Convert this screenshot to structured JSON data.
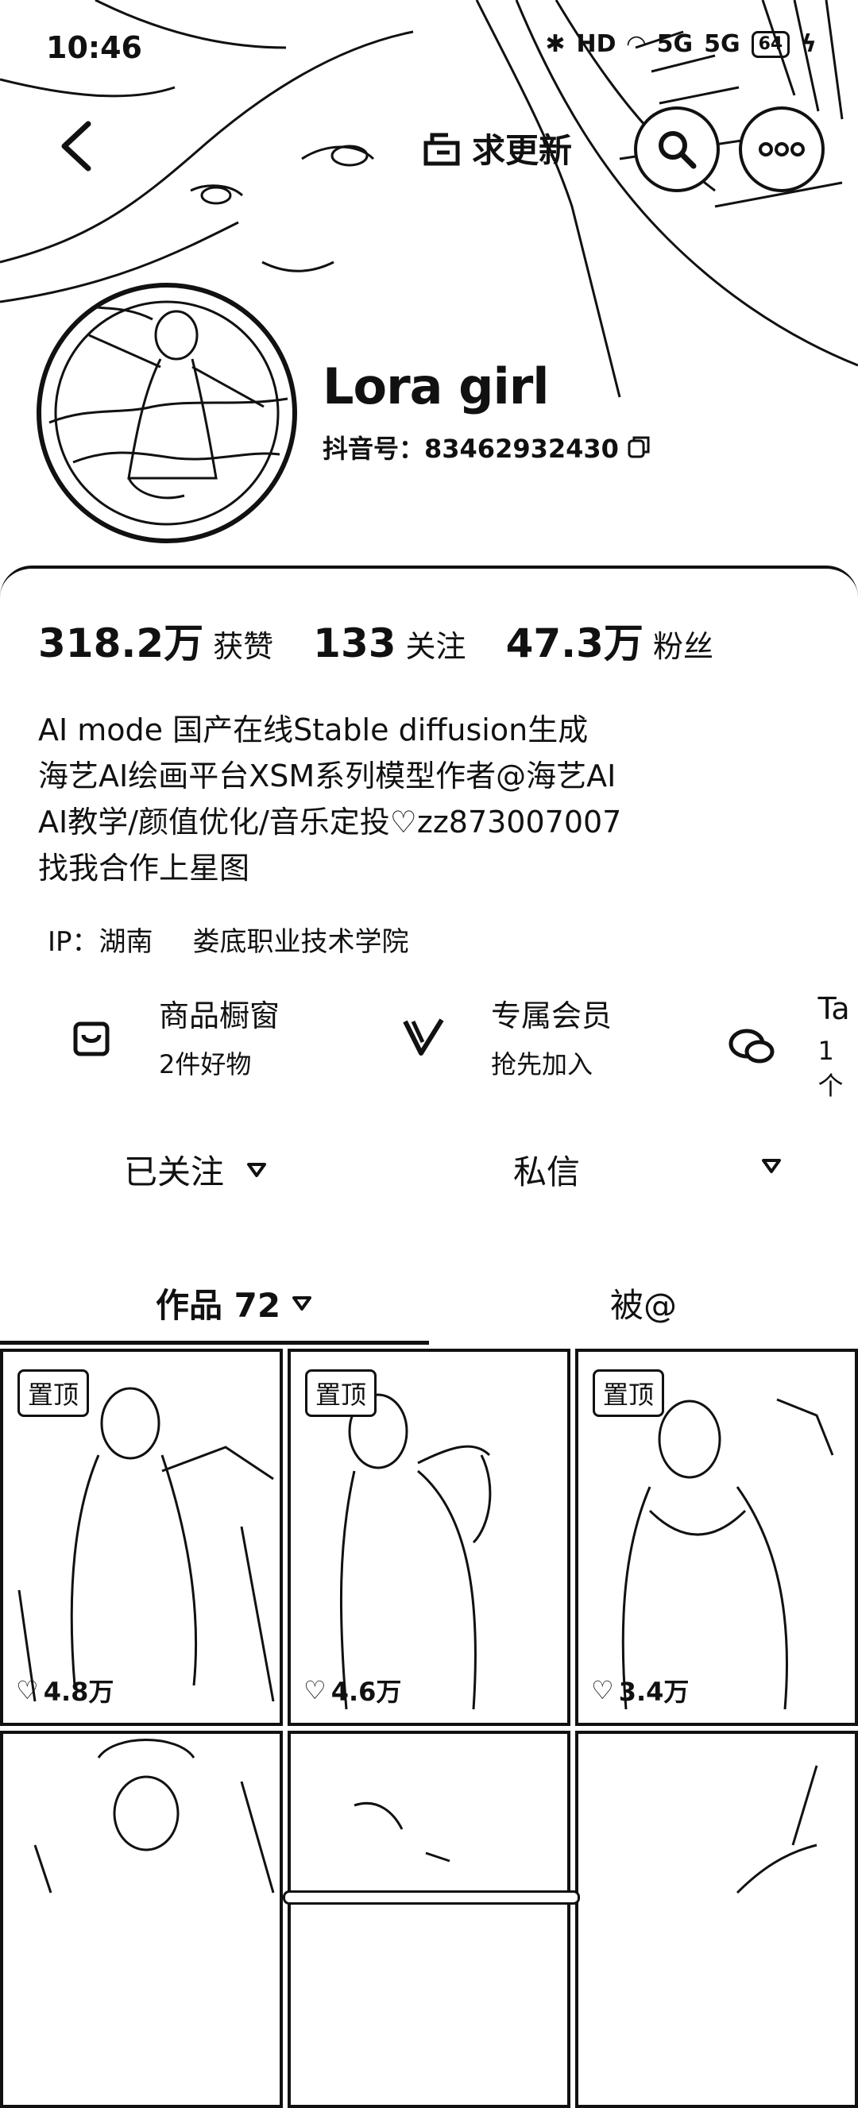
{
  "status_bar": {
    "time": "10:46",
    "network": "HD",
    "signal1": "5G",
    "signal2": "5G",
    "battery": "64"
  },
  "nav": {
    "request_update": "求更新"
  },
  "profile": {
    "name": "Lora girl",
    "uid": "抖音号：83462932430"
  },
  "stats": [
    {
      "num": "318.2万",
      "label": "获赞"
    },
    {
      "num": "133",
      "label": "关注"
    },
    {
      "num": "47.3万",
      "label": "粉丝"
    }
  ],
  "bio": [
    "AI mode 国产在线Stable diffusion生成",
    "海艺AI绘画平台XSM系列模型作者@海艺AI",
    "AI教学/颜值优化/音乐定投♡zz873007007",
    "找我合作上星图"
  ],
  "ip": {
    "region": "IP：湖南",
    "school": "娄底职业技术学院"
  },
  "features": [
    {
      "title": "商品橱窗",
      "sub": "2件好物",
      "icon": "bag-icon"
    },
    {
      "title": "专属会员",
      "sub": "抢先加入",
      "icon": "vip-icon"
    },
    {
      "title": "Ta",
      "sub": "1个",
      "icon": "chat-icon"
    }
  ],
  "actions": {
    "followed": "已关注",
    "message": "私信"
  },
  "tabs": {
    "works": "作品 72",
    "mentions": "被@"
  },
  "posts": [
    {
      "pinned": "置顶",
      "likes": "4.8万"
    },
    {
      "pinned": "置顶",
      "likes": "4.6万"
    },
    {
      "pinned": "置顶",
      "likes": "3.4万"
    },
    {
      "pinned": "",
      "likes": ""
    },
    {
      "pinned": "",
      "likes": ""
    },
    {
      "pinned": "",
      "likes": ""
    }
  ]
}
